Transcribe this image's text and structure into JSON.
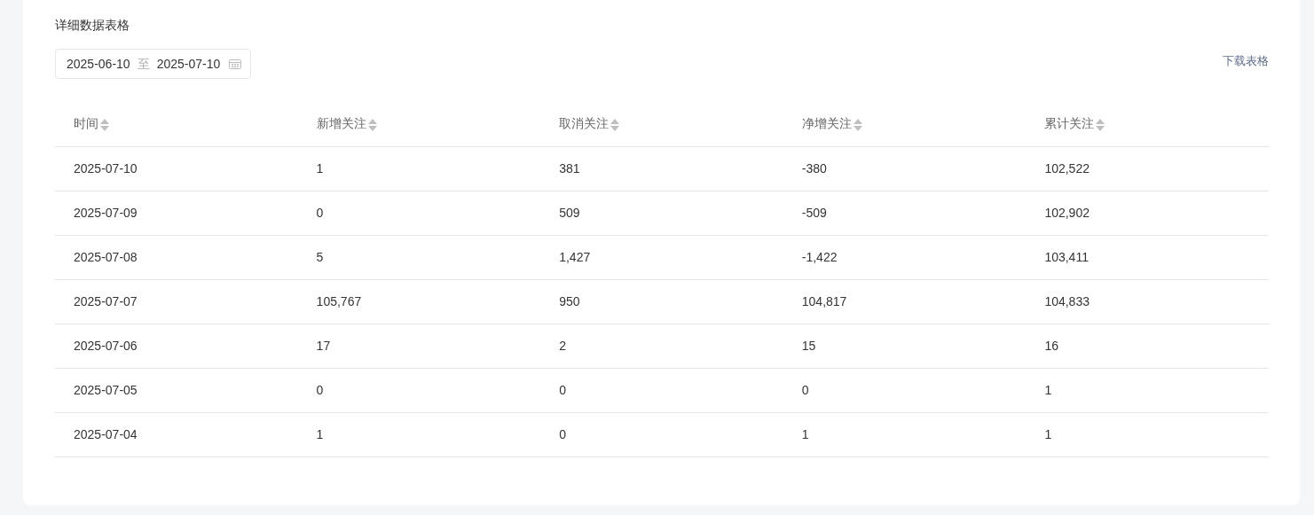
{
  "title": "详细数据表格",
  "date_range": {
    "start": "2025-06-10",
    "separator": "至",
    "end": "2025-07-10"
  },
  "download_link": "下载表格",
  "table": {
    "columns": [
      "时间",
      "新增关注",
      "取消关注",
      "净增关注",
      "累计关注"
    ],
    "rows": [
      [
        "2025-07-10",
        "1",
        "381",
        "-380",
        "102,522"
      ],
      [
        "2025-07-09",
        "0",
        "509",
        "-509",
        "102,902"
      ],
      [
        "2025-07-08",
        "5",
        "1,427",
        "-1,422",
        "103,411"
      ],
      [
        "2025-07-07",
        "105,767",
        "950",
        "104,817",
        "104,833"
      ],
      [
        "2025-07-06",
        "17",
        "2",
        "15",
        "16"
      ],
      [
        "2025-07-05",
        "0",
        "0",
        "0",
        "1"
      ],
      [
        "2025-07-04",
        "1",
        "0",
        "1",
        "1"
      ]
    ]
  }
}
